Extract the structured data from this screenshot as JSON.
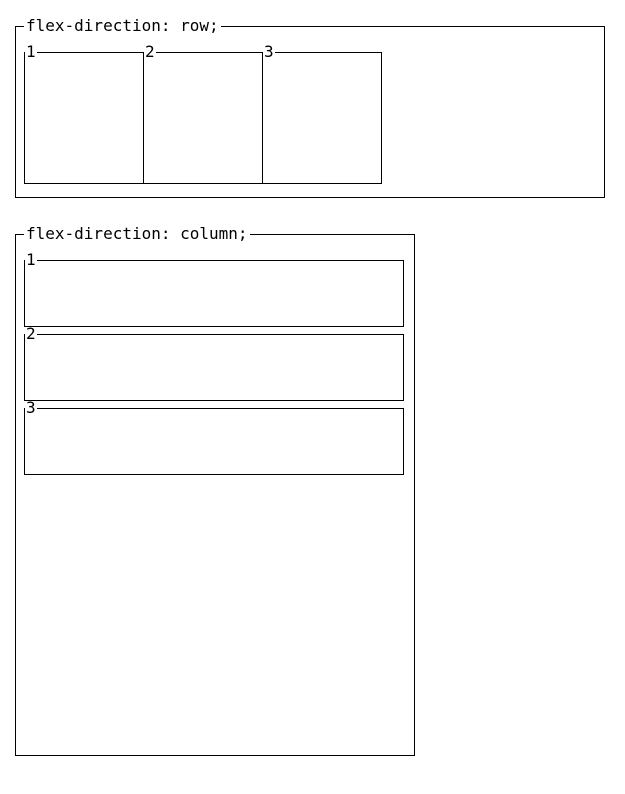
{
  "example_row": {
    "legend": "flex-direction: row;",
    "boxes": [
      "1",
      "2",
      "3"
    ]
  },
  "example_col": {
    "legend": "flex-direction: column;",
    "boxes": [
      "1",
      "2",
      "3"
    ]
  }
}
